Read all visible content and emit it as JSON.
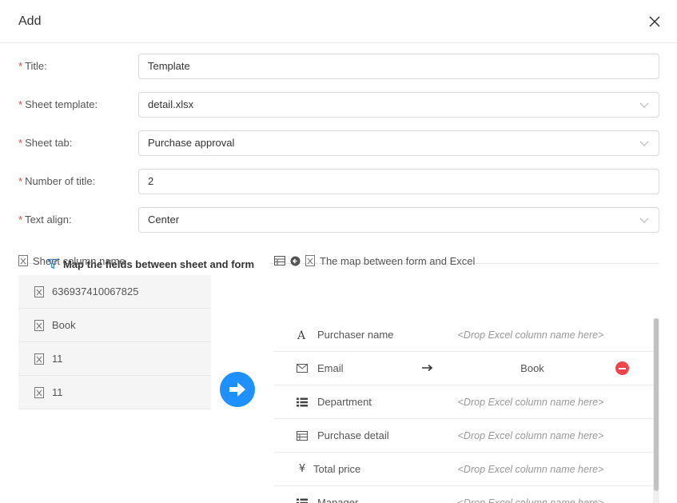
{
  "dialog": {
    "title": "Add"
  },
  "form": {
    "title": {
      "label": "Title:",
      "value": "Template"
    },
    "sheet_template": {
      "label": "Sheet template:",
      "value": "detail.xlsx"
    },
    "sheet_tab": {
      "label": "Sheet tab:",
      "value": "Purchase approval"
    },
    "number_of_title": {
      "label": "Number of title:",
      "value": "2"
    },
    "text_align": {
      "label": "Text align:",
      "value": "Center"
    },
    "required_mark": "*"
  },
  "mapping": {
    "section_title": "Map the fields between sheet and form",
    "sheet_panel_title": "Sheet column name",
    "map_panel_title": "The map between form and Excel",
    "sheet_columns": [
      "636937410067825",
      "Book",
      "11",
      "11"
    ],
    "placeholder": "<Drop Excel column name here>",
    "fields": [
      {
        "icon": "text-icon",
        "name": "Purchaser name",
        "mapped": ""
      },
      {
        "icon": "envelope-icon",
        "name": "Email",
        "mapped": "Book"
      },
      {
        "icon": "list-icon",
        "name": "Department",
        "mapped": ""
      },
      {
        "icon": "table-icon",
        "name": "Purchase detail",
        "mapped": ""
      },
      {
        "icon": "yen-icon",
        "name": "Total price",
        "mapped": ""
      },
      {
        "icon": "list-icon",
        "name": "Manager",
        "mapped": ""
      }
    ]
  },
  "colors": {
    "accent": "#1e90ff",
    "danger": "#f0434c",
    "required": "#e5484d"
  }
}
